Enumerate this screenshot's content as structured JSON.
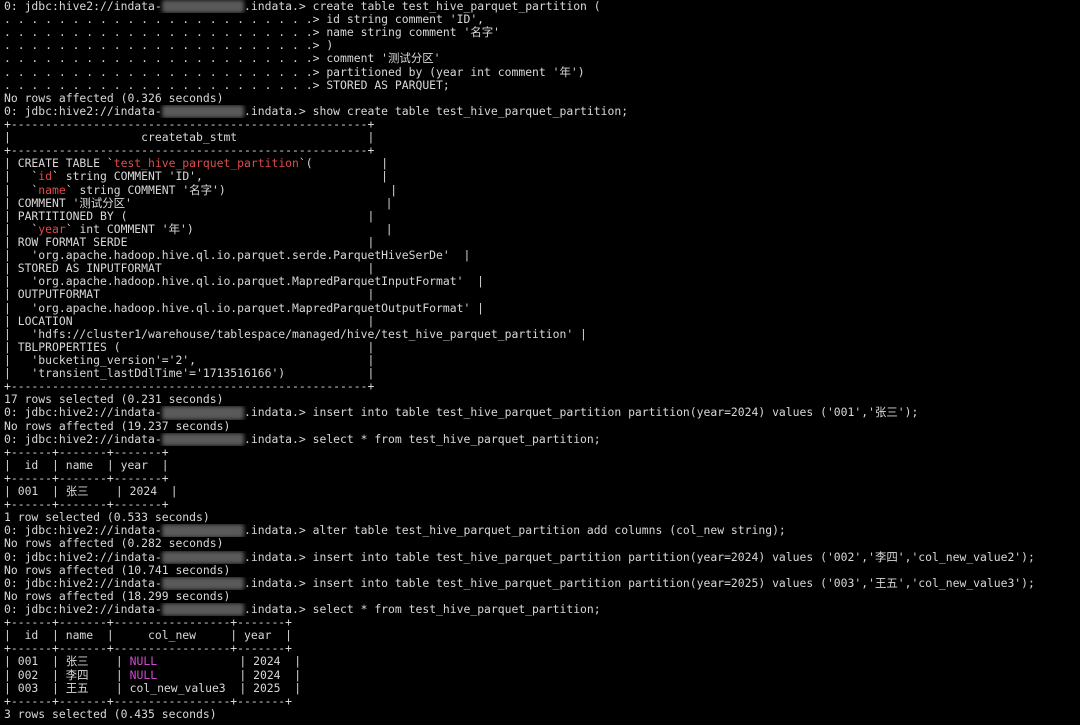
{
  "terminal": {
    "lines": [
      [
        {
          "t": "0: jdbc:hive2://indata-"
        },
        {
          "t": "            ",
          "s": "mask"
        },
        {
          "t": ".indata.> create table test_hive_parquet_partition ("
        }
      ],
      [
        {
          "t": ". . . . . . . . . . . . . . . . . . . . . . .> id string comment 'ID',"
        }
      ],
      [
        {
          "t": ". . . . . . . . . . . . . . . . . . . . . . .> name string comment '名字'"
        }
      ],
      [
        {
          "t": ". . . . . . . . . . . . . . . . . . . . . . .> )"
        }
      ],
      [
        {
          "t": ". . . . . . . . . . . . . . . . . . . . . . .> comment '测试分区'"
        }
      ],
      [
        {
          "t": ". . . . . . . . . . . . . . . . . . . . . . .> partitioned by (year int comment '年')"
        }
      ],
      [
        {
          "t": ". . . . . . . . . . . . . . . . . . . . . . .> STORED AS PARQUET;"
        }
      ],
      [
        {
          "t": "No rows affected (0.326 seconds)"
        }
      ],
      [
        {
          "t": "0: jdbc:hive2://indata-"
        },
        {
          "t": "            ",
          "s": "mask"
        },
        {
          "t": ".indata.> show create table test_hive_parquet_partition;"
        }
      ],
      [
        {
          "t": "+----------------------------------------------------+"
        }
      ],
      [
        {
          "t": "|                   createtab_stmt                   |"
        }
      ],
      [
        {
          "t": "+----------------------------------------------------+"
        }
      ],
      [
        {
          "t": "| CREATE TABLE `"
        },
        {
          "t": "test_hive_parquet_partition",
          "s": "red"
        },
        {
          "t": "`(          |"
        }
      ],
      [
        {
          "t": "|   `"
        },
        {
          "t": "id",
          "s": "red"
        },
        {
          "t": "` string COMMENT 'ID',                          |"
        }
      ],
      [
        {
          "t": "|   `"
        },
        {
          "t": "name",
          "s": "red"
        },
        {
          "t": "` string COMMENT '名字')                        |"
        }
      ],
      [
        {
          "t": "| COMMENT '测试分区'                                     |"
        }
      ],
      [
        {
          "t": "| PARTITIONED BY (                                   |"
        }
      ],
      [
        {
          "t": "|   `"
        },
        {
          "t": "year",
          "s": "red"
        },
        {
          "t": "` int COMMENT '年')                            |"
        }
      ],
      [
        {
          "t": "| ROW FORMAT SERDE                                   |"
        }
      ],
      [
        {
          "t": "|   'org.apache.hadoop.hive.ql.io.parquet.serde.ParquetHiveSerDe'  |"
        }
      ],
      [
        {
          "t": "| STORED AS INPUTFORMAT                              |"
        }
      ],
      [
        {
          "t": "|   'org.apache.hadoop.hive.ql.io.parquet.MapredParquetInputFormat'  |"
        }
      ],
      [
        {
          "t": "| OUTPUTFORMAT                                       |"
        }
      ],
      [
        {
          "t": "|   'org.apache.hadoop.hive.ql.io.parquet.MapredParquetOutputFormat' |"
        }
      ],
      [
        {
          "t": "| LOCATION                                           |"
        }
      ],
      [
        {
          "t": "|   'hdfs://cluster1/warehouse/tablespace/managed/hive/test_hive_parquet_partition' |"
        }
      ],
      [
        {
          "t": "| TBLPROPERTIES (                                    |"
        }
      ],
      [
        {
          "t": "|   'bucketing_version'='2',                         |"
        }
      ],
      [
        {
          "t": "|   'transient_lastDdlTime'='1713516166')            |"
        }
      ],
      [
        {
          "t": "+----------------------------------------------------+"
        }
      ],
      [
        {
          "t": "17 rows selected (0.231 seconds)"
        }
      ],
      [
        {
          "t": "0: jdbc:hive2://indata-"
        },
        {
          "t": "            ",
          "s": "mask"
        },
        {
          "t": ".indata.> insert into table test_hive_parquet_partition partition(year=2024) values ('001','张三');"
        }
      ],
      [
        {
          "t": "No rows affected (19.237 seconds)"
        }
      ],
      [
        {
          "t": "0: jdbc:hive2://indata-"
        },
        {
          "t": "            ",
          "s": "mask"
        },
        {
          "t": ".indata.> select * from test_hive_parquet_partition;"
        }
      ],
      [
        {
          "t": "+------+-------+-------+"
        }
      ],
      [
        {
          "t": "|  id  | name  | year  |"
        }
      ],
      [
        {
          "t": "+------+-------+-------+"
        }
      ],
      [
        {
          "t": "| 001  | 张三    | 2024  |"
        }
      ],
      [
        {
          "t": "+------+-------+-------+"
        }
      ],
      [
        {
          "t": "1 row selected (0.533 seconds)"
        }
      ],
      [
        {
          "t": "0: jdbc:hive2://indata-"
        },
        {
          "t": "            ",
          "s": "mask"
        },
        {
          "t": ".indata.> alter table test_hive_parquet_partition add columns (col_new string);"
        }
      ],
      [
        {
          "t": "No rows affected (0.282 seconds)"
        }
      ],
      [
        {
          "t": "0: jdbc:hive2://indata-"
        },
        {
          "t": "            ",
          "s": "mask"
        },
        {
          "t": ".indata.> insert into table test_hive_parquet_partition partition(year=2024) values ('002','李四','col_new_value2');"
        }
      ],
      [
        {
          "t": "No rows affected (10.741 seconds)"
        }
      ],
      [
        {
          "t": "0: jdbc:hive2://indata-"
        },
        {
          "t": "            ",
          "s": "mask"
        },
        {
          "t": ".indata.> insert into table test_hive_parquet_partition partition(year=2025) values ('003','王五','col_new_value3');"
        }
      ],
      [
        {
          "t": "No rows affected (18.299 seconds)"
        }
      ],
      [
        {
          "t": "0: jdbc:hive2://indata-"
        },
        {
          "t": "            ",
          "s": "mask"
        },
        {
          "t": ".indata.> select * from test_hive_parquet_partition;"
        }
      ],
      [
        {
          "t": "+------+-------+-----------------+-------+"
        }
      ],
      [
        {
          "t": "|  id  | name  |     col_new     | year  |"
        }
      ],
      [
        {
          "t": "+------+-------+-----------------+-------+"
        }
      ],
      [
        {
          "t": "| 001  | 张三    | "
        },
        {
          "t": "NULL",
          "s": "mag"
        },
        {
          "t": "            | 2024  |"
        }
      ],
      [
        {
          "t": "| 002  | 李四    | "
        },
        {
          "t": "NULL",
          "s": "mag"
        },
        {
          "t": "            | 2024  |"
        }
      ],
      [
        {
          "t": "| 003  | 王五    | col_new_value3  | 2025  |"
        }
      ],
      [
        {
          "t": "+------+-------+-----------------+-------+"
        }
      ],
      [
        {
          "t": "3 rows selected (0.435 seconds)"
        }
      ]
    ]
  }
}
